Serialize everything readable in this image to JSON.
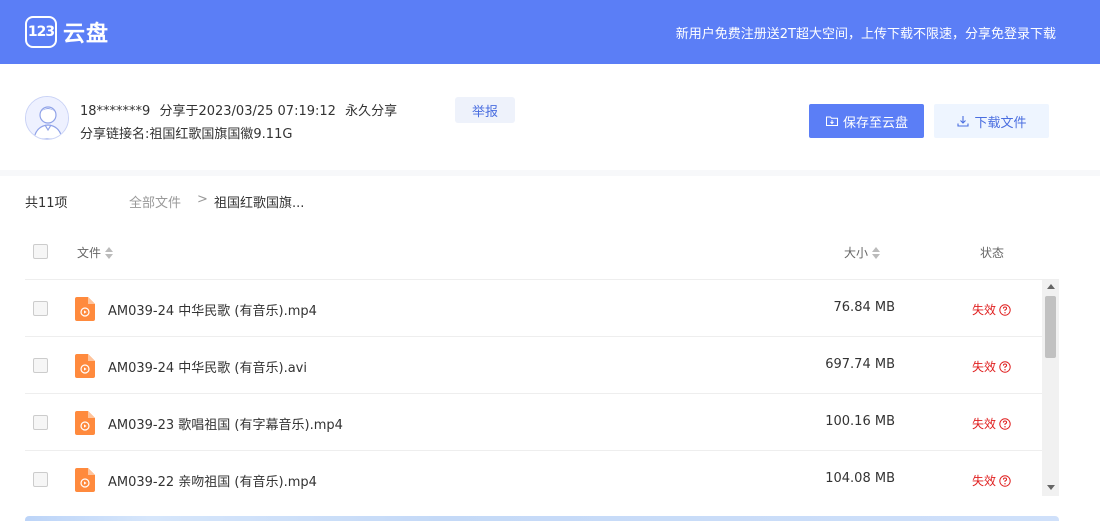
{
  "header": {
    "logo_mark": "123",
    "logo_text": "云盘",
    "slogan": "新用户免费注册送2T超大空间，上传下载不限速，分享免登录下载",
    "brand_color": "#5b7ef6"
  },
  "share": {
    "user": "18*******9",
    "shared_at": "分享于2023/03/25 07:19:12",
    "validity": "永久分享",
    "link_name_label": "分享链接名:",
    "link_name": "祖国红歌国旗国徽9.11G",
    "report_label": "举报",
    "save_label": "保存至云盘",
    "download_label": "下载文件",
    "avatar_icon": "user-avatar"
  },
  "list": {
    "count": "共11项",
    "breadcrumb_root": "全部文件",
    "breadcrumb_sep": ">",
    "breadcrumb_current": "祖国红歌国旗...",
    "columns": {
      "file": "文件",
      "size": "大小",
      "state": "状态"
    },
    "rows": [
      {
        "name": "AM039-24 中华民歌 (有音乐).mp4",
        "size": "76.84 MB",
        "state": "失效"
      },
      {
        "name": "AM039-24 中华民歌 (有音乐).avi",
        "size": "697.74 MB",
        "state": "失效"
      },
      {
        "name": "AM039-23 歌唱祖国 (有字幕音乐).mp4",
        "size": "100.16 MB",
        "state": "失效"
      },
      {
        "name": "AM039-22 亲吻祖国 (有音乐).mp4",
        "size": "104.08 MB",
        "state": "失效"
      }
    ],
    "state_color": "#e02020",
    "file_icon_color": "#ff8a3d"
  }
}
